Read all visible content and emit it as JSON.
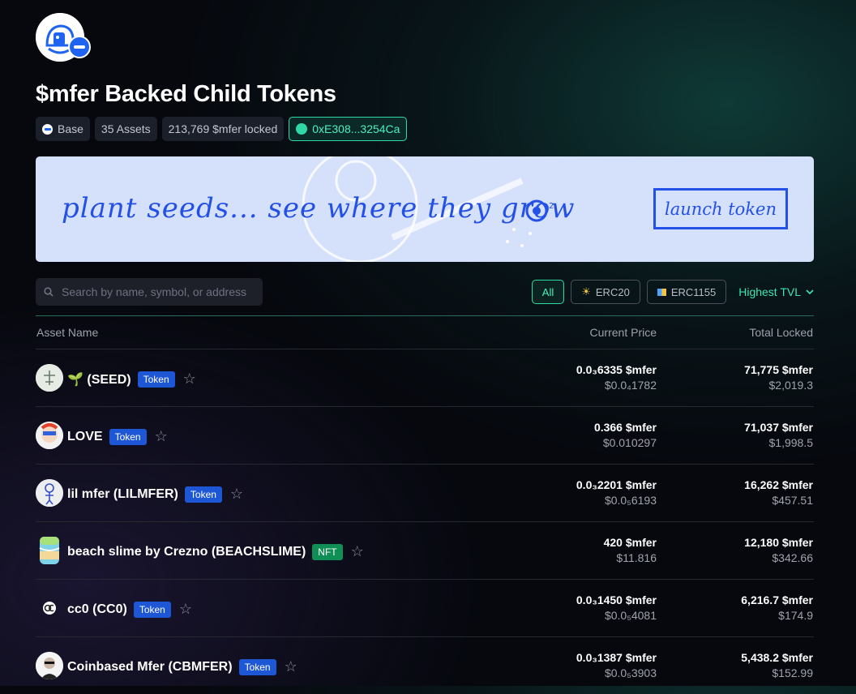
{
  "header": {
    "title": "$mfer Backed Child Tokens",
    "chips": {
      "network": "Base",
      "assets": "35 Assets",
      "locked": "213,769 $mfer locked",
      "address": "0xE308...3254Ca"
    }
  },
  "banner": {
    "text": "plant seeds... see where they grow",
    "button": "launch token"
  },
  "search": {
    "placeholder": "Search by name, symbol, or address"
  },
  "filters": {
    "all": "All",
    "erc20": "ERC20",
    "erc1155": "ERC1155",
    "sort": "Highest TVL"
  },
  "table": {
    "headers": {
      "name": "Asset Name",
      "price": "Current Price",
      "locked": "Total Locked"
    },
    "rows": [
      {
        "name": "🌱 (SEED)",
        "badge": "Token",
        "price_mfer": "0.0₃6335 $mfer",
        "price_usd": "$0.0₄1782",
        "locked_mfer": "71,775 $mfer",
        "locked_usd": "$2,019.3"
      },
      {
        "name": "LOVE",
        "badge": "Token",
        "price_mfer": "0.366 $mfer",
        "price_usd": "$0.010297",
        "locked_mfer": "71,037 $mfer",
        "locked_usd": "$1,998.5"
      },
      {
        "name": "lil mfer (LILMFER)",
        "badge": "Token",
        "price_mfer": "0.0₃2201 $mfer",
        "price_usd": "$0.0₅6193",
        "locked_mfer": "16,262 $mfer",
        "locked_usd": "$457.51"
      },
      {
        "name": "beach slime by Crezno (BEACHSLIME)",
        "badge": "NFT",
        "price_mfer": "420 $mfer",
        "price_usd": "$11.816",
        "locked_mfer": "12,180 $mfer",
        "locked_usd": "$342.66"
      },
      {
        "name": "cc0 (CC0)",
        "badge": "Token",
        "price_mfer": "0.0₃1450 $mfer",
        "price_usd": "$0.0₅4081",
        "locked_mfer": "6,216.7 $mfer",
        "locked_usd": "$174.9"
      },
      {
        "name": "Coinbased Mfer (CBMFER)",
        "badge": "Token",
        "price_mfer": "0.0₃1387 $mfer",
        "price_usd": "$0.0₅3903",
        "locked_mfer": "5,438.2 $mfer",
        "locked_usd": "$152.99"
      }
    ]
  },
  "colors": {
    "accent": "#2fd9a6",
    "brand_blue": "#1f64f0",
    "nft_green": "#0f8f55"
  }
}
